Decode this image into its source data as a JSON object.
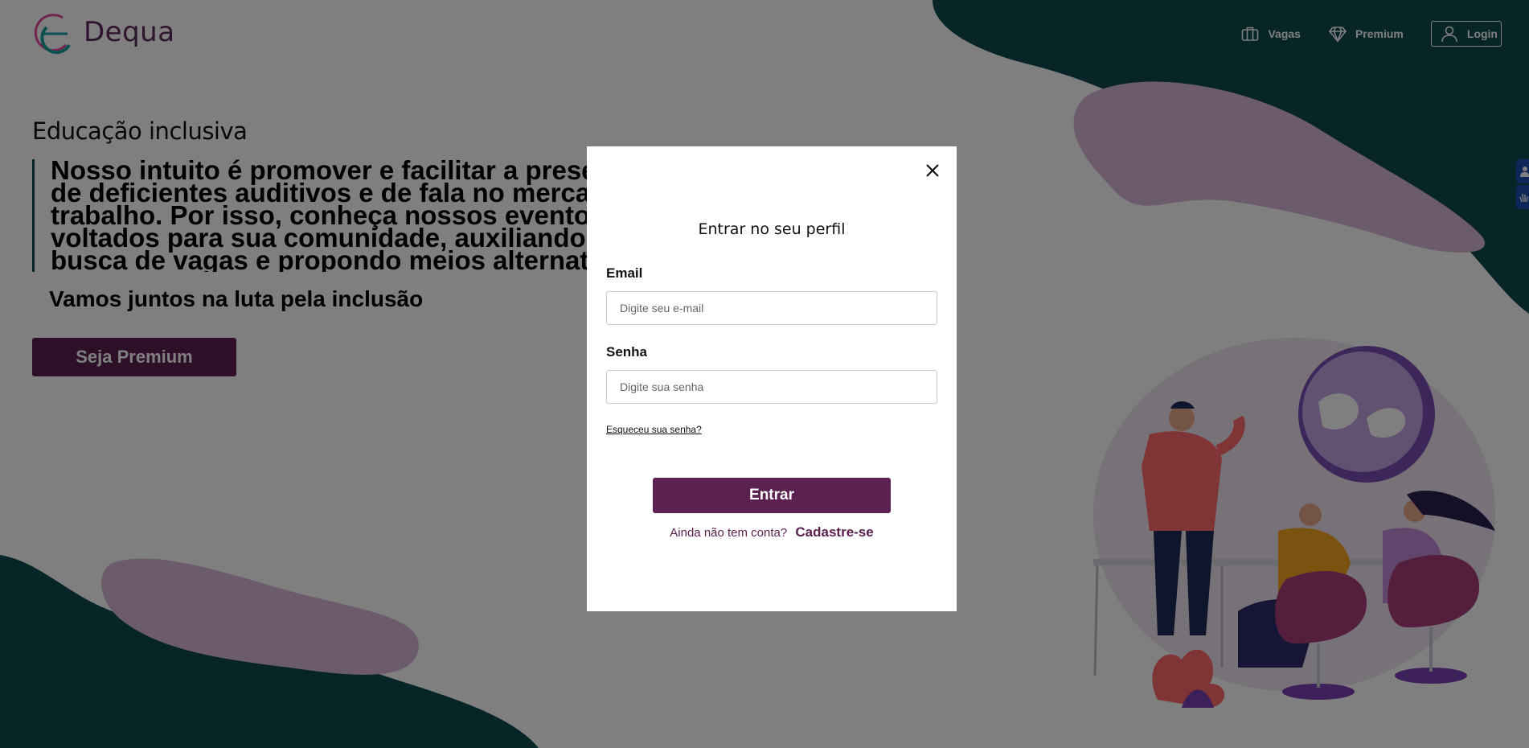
{
  "brand": {
    "name": "Dequa"
  },
  "nav": {
    "vagas": "Vagas",
    "premium": "Premium",
    "login": "Login"
  },
  "hero": {
    "title": "Educação inclusiva",
    "quote": "Nosso intuito é promover e facilitar a presença de deficientes auditivos e de fala no mercado de trabalho. Por isso, conheça nossos eventos voltados para sua comunidade, auxiliando na busca de vagas e propondo meios alternativos para sua capacitação.",
    "subtitle": "Vamos juntos na luta pela inclusão",
    "cta": "Seja Premium"
  },
  "modal": {
    "title": "Entrar no seu perfil",
    "email_label": "Email",
    "email_placeholder": "Digite seu e-mail",
    "password_label": "Senha",
    "password_placeholder": "Digite sua senha",
    "forgot": "Esqueceu sua senha?",
    "submit": "Entrar",
    "no_account": "Ainda não tem conta?",
    "signup": "Cadastre-se"
  },
  "colors": {
    "brand_purple": "#5b2150",
    "teal_dark": "#0e4a4e",
    "lilac": "#d9b6d6",
    "a11y_blue": "#1a4fb0"
  }
}
